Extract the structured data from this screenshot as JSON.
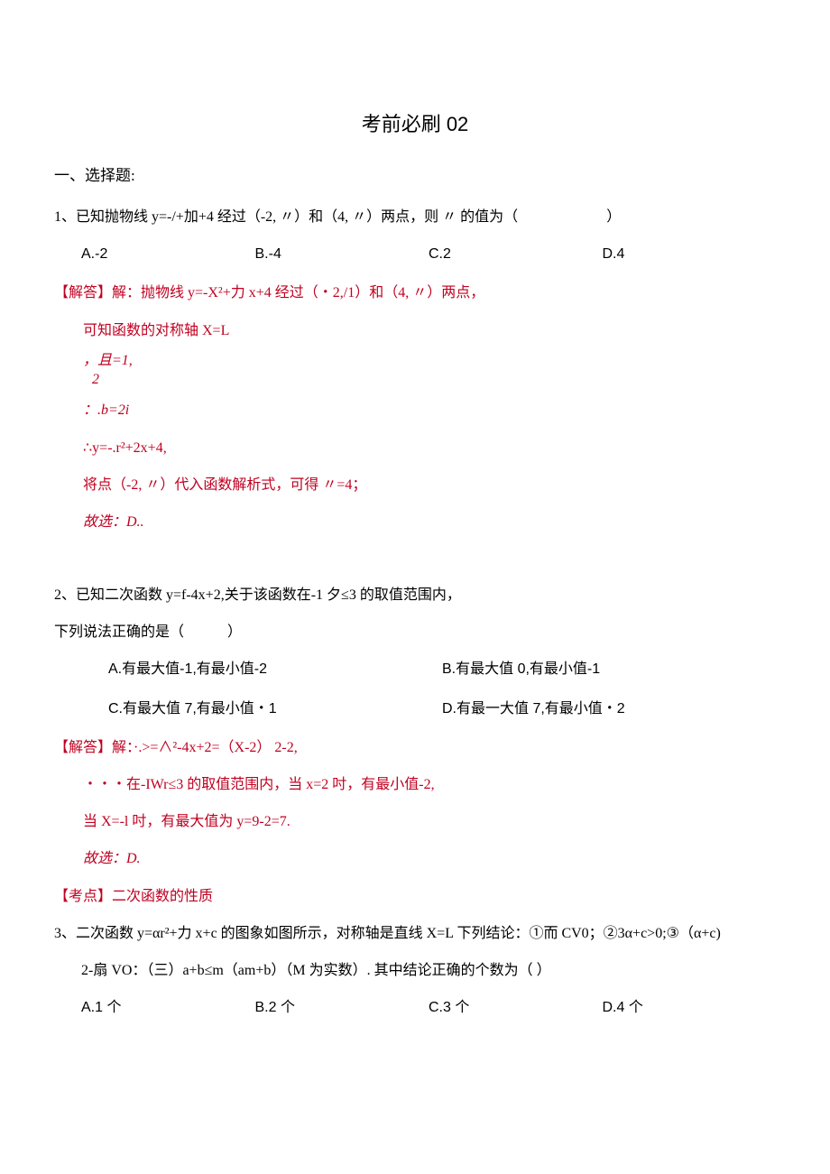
{
  "title": "考前必刷 02",
  "section1_heading": "一、选择题:",
  "q1": {
    "stem": "1、已知抛物线 y=-/+加+4 经过（-2, 〃）和（4, 〃）两点，则 〃 的值为（",
    "stem_paren_close": "）",
    "opts": {
      "a": "A.-2",
      "b": "B.-4",
      "c": "C.2",
      "d": "D.4"
    },
    "sol": {
      "l1": "【解答】解：抛物线 y=-X²+力 x+4 经过（・2,/1）和（4, 〃）两点，",
      "l2": "可知函数的对称轴 X=L",
      "l3a": "，且=1,",
      "l3b": "2",
      "l4": "：.b=2i",
      "l5": "∴y=-.r²+2x+4,",
      "l6": "将点（-2, 〃）代入函数解析式，可得 〃=4；",
      "l7": "故选：D.."
    }
  },
  "q2": {
    "stem1": "2、已知二次函数 y=f-4x+2,关于该函数在-1 夕≤3 的取值范围内，",
    "stem2": "下列说法正确的是（",
    "stem2_paren_close": "）",
    "opts": {
      "a": "A.有最大值-1,有最小值-2",
      "b": "B.有最大值 0,有最小值-1",
      "c": "C.有最大值 7,有最小值・1",
      "d": "D.有最一大值 7,有最小值・2"
    },
    "sol": {
      "l1": "【解答】解：·.>=∧²-4x+2=（X-2） 2-2,",
      "l2": "・・・在-IWr≤3 的取值范围内，当 x=2 吋，有最小值-2,",
      "l3": "当 X=-l 吋，有最大值为 y=9-2=7.",
      "l4": "故选：D."
    },
    "topic": "【考点】二次函数的性质"
  },
  "q3": {
    "stem1": "3、二次函数 y=αr²+力 x+c 的图象如图所示，对称轴是直线 X=L 下列结论：①而 CV0；②3α+c>0;③（α+c)",
    "stem2": "2-扇 VO：（三）a+b≤m（am+b）（M 为实数）. 其中结论正确的个数为（ ）",
    "opts": {
      "a": "A.1 个",
      "b": "B.2 个",
      "c": "C.3 个",
      "d": "D.4 个"
    }
  }
}
